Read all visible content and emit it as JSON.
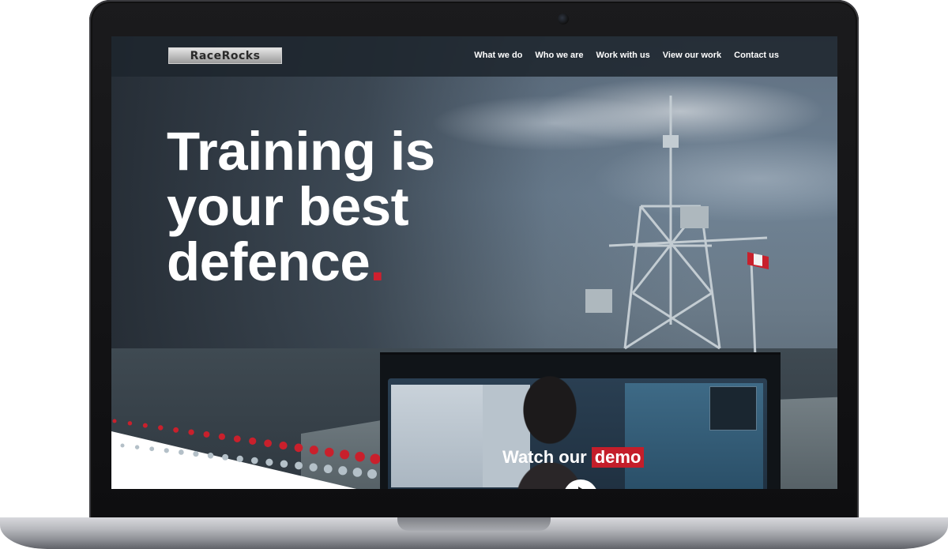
{
  "site": {
    "logo_text": "RaceRocks",
    "nav": [
      {
        "label": "What we do"
      },
      {
        "label": "Who we are"
      },
      {
        "label": "Work with us"
      },
      {
        "label": "View our work"
      },
      {
        "label": "Contact us"
      }
    ]
  },
  "hero": {
    "headline_lines": [
      "Training is",
      "your best",
      "defence"
    ],
    "headline_period": ".",
    "accent_color": "#d0202e"
  },
  "video": {
    "label_prefix": "Watch our",
    "label_accent": "demo",
    "play_icon": "play-icon"
  }
}
